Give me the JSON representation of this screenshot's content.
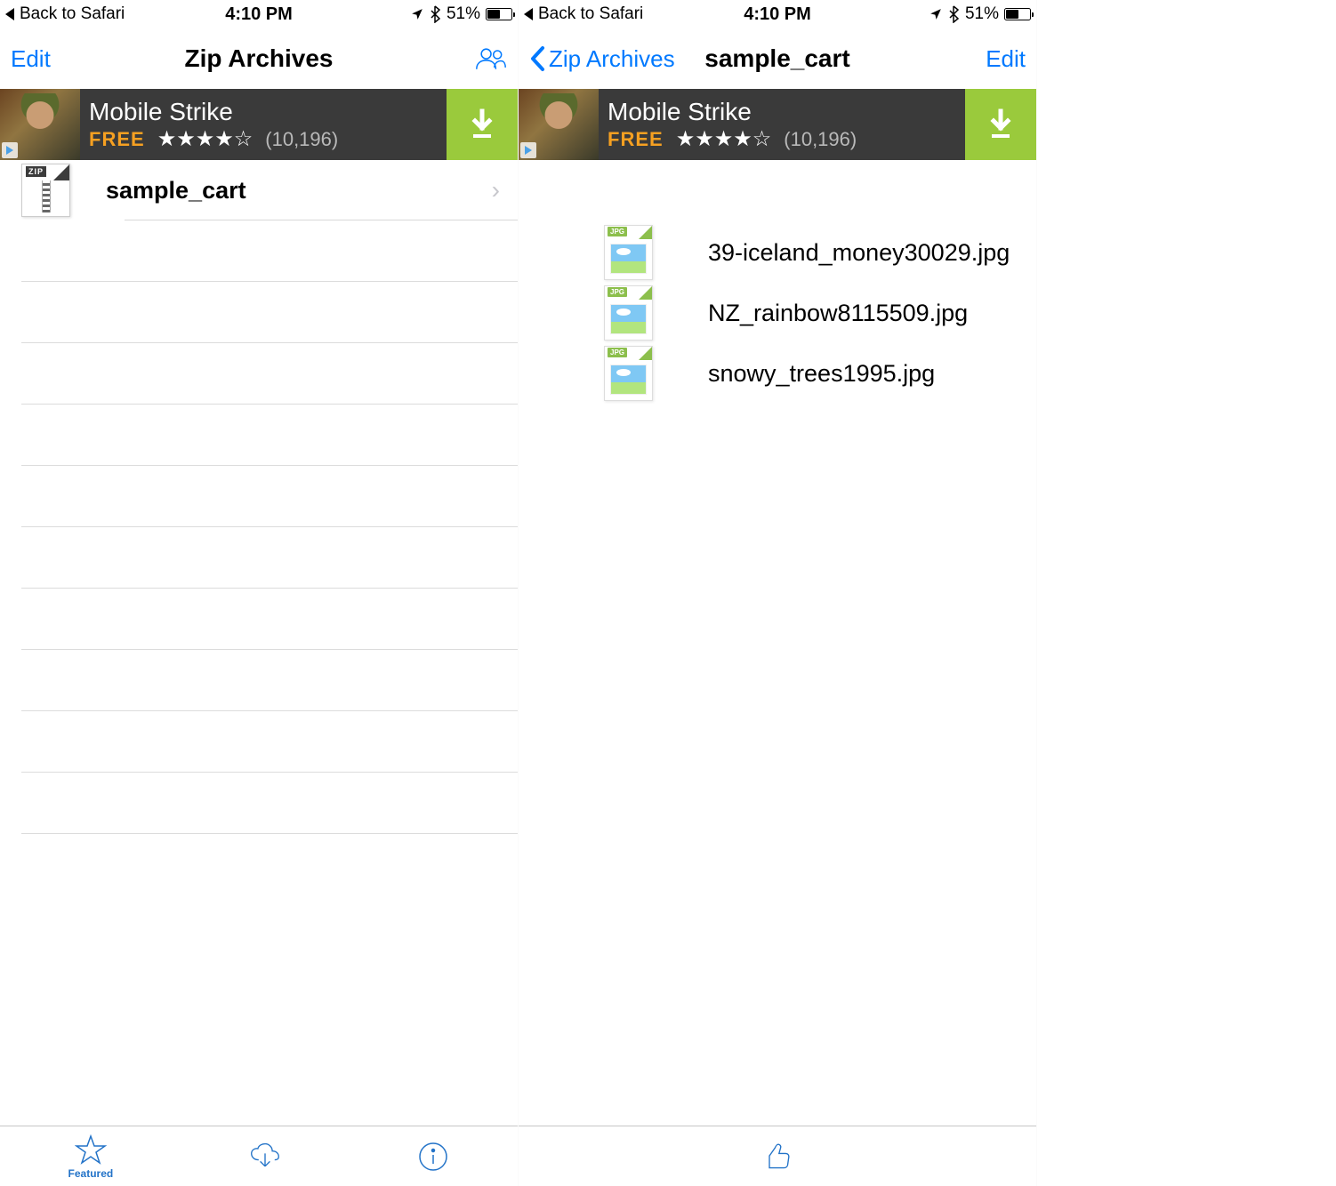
{
  "status": {
    "back_app": "Back to Safari",
    "time": "4:10 PM",
    "battery_pct": "51%"
  },
  "left": {
    "nav_edit": "Edit",
    "nav_title": "Zip Archives",
    "ad": {
      "title": "Mobile Strike",
      "free": "FREE",
      "rating_count": "(10,196)"
    },
    "archives": [
      {
        "name": "sample_cart"
      }
    ],
    "tab_featured": "Featured"
  },
  "right": {
    "nav_back": "Zip Archives",
    "nav_title": "sample_cart",
    "nav_edit": "Edit",
    "ad": {
      "title": "Mobile Strike",
      "free": "FREE",
      "rating_count": "(10,196)"
    },
    "files": [
      "39-iceland_money30029.jpg",
      "NZ_rainbow8115509.jpg",
      "snowy_trees1995.jpg"
    ]
  }
}
